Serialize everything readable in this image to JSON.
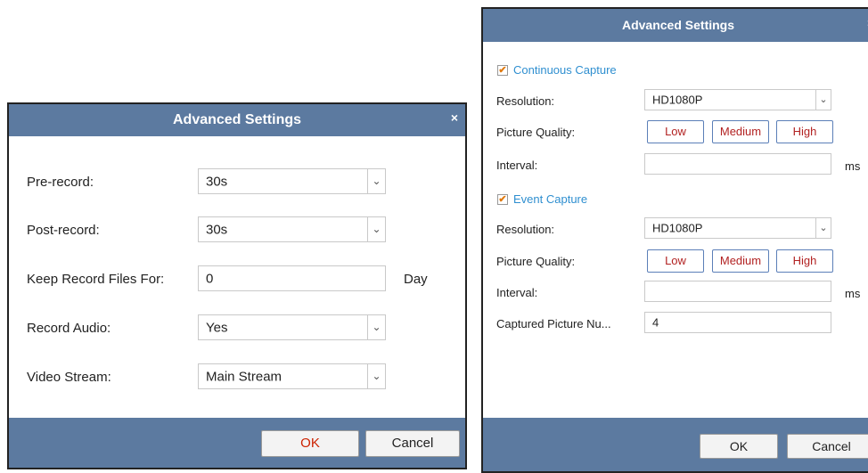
{
  "left_dialog": {
    "title": "Advanced Settings",
    "close": "×",
    "pre_record": {
      "label": "Pre-record:",
      "value": "30s"
    },
    "post_record": {
      "label": "Post-record:",
      "value": "30s"
    },
    "keep_record": {
      "label": "Keep Record Files For:",
      "value": "0",
      "unit": "Day"
    },
    "record_audio": {
      "label": "Record Audio:",
      "value": "Yes"
    },
    "video_stream": {
      "label": "Video Stream:",
      "value": "Main Stream"
    },
    "ok_label": "OK",
    "cancel_label": "Cancel"
  },
  "right_dialog": {
    "title": "Advanced Settings",
    "close": "×",
    "continuous": {
      "section_label": "Continuous Capture",
      "checked": true,
      "resolution": {
        "label": "Resolution:",
        "value": "HD1080P"
      },
      "quality": {
        "label": "Picture Quality:",
        "low": "Low",
        "medium": "Medium",
        "high": "High"
      },
      "interval": {
        "label": "Interval:",
        "value": "",
        "unit": "ms"
      }
    },
    "event": {
      "section_label": "Event Capture",
      "checked": true,
      "resolution": {
        "label": "Resolution:",
        "value": "HD1080P"
      },
      "quality": {
        "label": "Picture Quality:",
        "low": "Low",
        "medium": "Medium",
        "high": "High"
      },
      "interval": {
        "label": "Interval:",
        "value": "",
        "unit": "ms"
      },
      "captured_number": {
        "label": "Captured Picture Nu...",
        "value": "4"
      }
    },
    "ok_label": "OK",
    "cancel_label": "Cancel"
  },
  "icons": {
    "checkmark": "✔",
    "dropdown": "chevron-down-icon",
    "close": "close-icon"
  },
  "colors": {
    "titlebar": "#5c7aa0",
    "section_label": "#2f8fd0",
    "quality_text": "#b22222",
    "ok_text": "#cc2200",
    "check": "#e07a10"
  }
}
